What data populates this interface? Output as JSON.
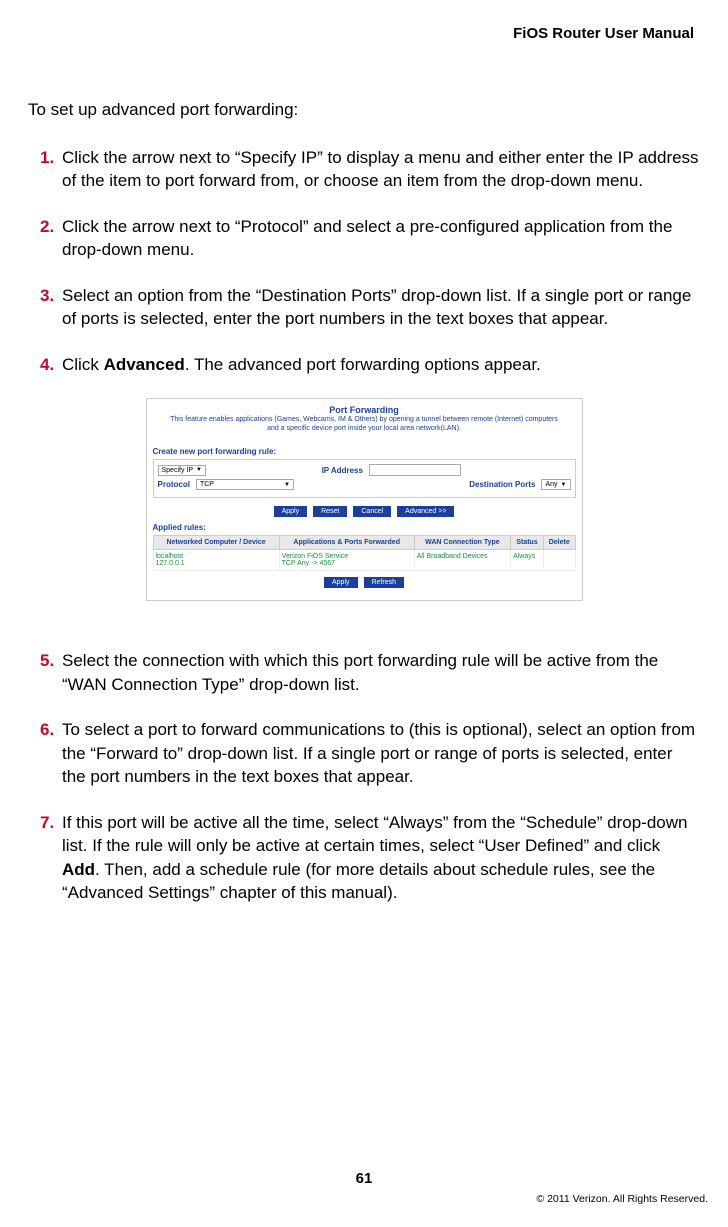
{
  "header": {
    "title": "FiOS Router User Manual"
  },
  "intro": "To set up advanced port forwarding:",
  "steps": {
    "s1": {
      "num": "1.",
      "text": "Click the arrow next to “Specify IP” to display  a menu and either enter the IP address of the item to port forward from, or choose an item from the drop-down menu."
    },
    "s2": {
      "num": "2.",
      "text": "Click the arrow next to “Protocol” and select a pre-configured application from the drop-down menu."
    },
    "s3": {
      "num": "3.",
      "text": "Select an option from the “Destination Ports” drop-down list. If a single port or range of ports is selected, enter the port numbers in the text boxes that appear."
    },
    "s4": {
      "num": "4.",
      "pre": "Click ",
      "bold": "Advanced",
      "post": ".  The advanced port forwarding options appear."
    },
    "s5": {
      "num": "5.",
      "text": "Select the connection with which this port forwarding rule will be active from the “WAN Connection Type” drop-down list."
    },
    "s6": {
      "num": "6.",
      "text": "To select a port to forward communications to (this is optional), select an option from the “Forward to” drop-down list. If a single port or range of ports is selected, enter the port numbers in the text boxes that appear."
    },
    "s7": {
      "num": "7.",
      "pre": "If this port will be active all the time, select “Always” from the “Schedule” drop-down list. If the rule will only be active at certain times, select “User Defined” and click ",
      "bold": "Add",
      "post": ". Then, add a schedule rule (for more details about schedule rules, see the “Advanced Settings” chapter of this manual)."
    }
  },
  "panel": {
    "title": "Port Forwarding",
    "desc": "This feature enables applications (Games, Webcams, IM & Others) by opening a tunnel between remote (Internet) computers and a specific device port inside your local area network(LAN).",
    "create_head": "Create new port forwarding rule:",
    "specify_ip": "Specify IP",
    "ip_label": "IP Address",
    "protocol_label": "Protocol",
    "protocol_value": "TCP",
    "dest_label": "Destination Ports",
    "dest_value": "Any",
    "buttons": {
      "apply": "Apply",
      "reset": "Reset",
      "cancel": "Cancel",
      "advanced": "Advanced >>",
      "refresh": "Refresh"
    },
    "applied_head": "Applied rules:",
    "table": {
      "h1": "Networked Computer / Device",
      "h2": "Applications & Ports Forwarded",
      "h3": "WAN Connection Type",
      "h4": "Status",
      "h5": "Delete",
      "row": {
        "c1a": "localhost",
        "c1b": "127.0.0.1",
        "c2a": "Verizon FiOS Service",
        "c2b": "TCP Any -> 4567",
        "c3": "All Broadband Devices",
        "c4": "Always"
      }
    }
  },
  "footer": {
    "page": "61",
    "copyright": "© 2011 Verizon. All Rights Reserved."
  }
}
